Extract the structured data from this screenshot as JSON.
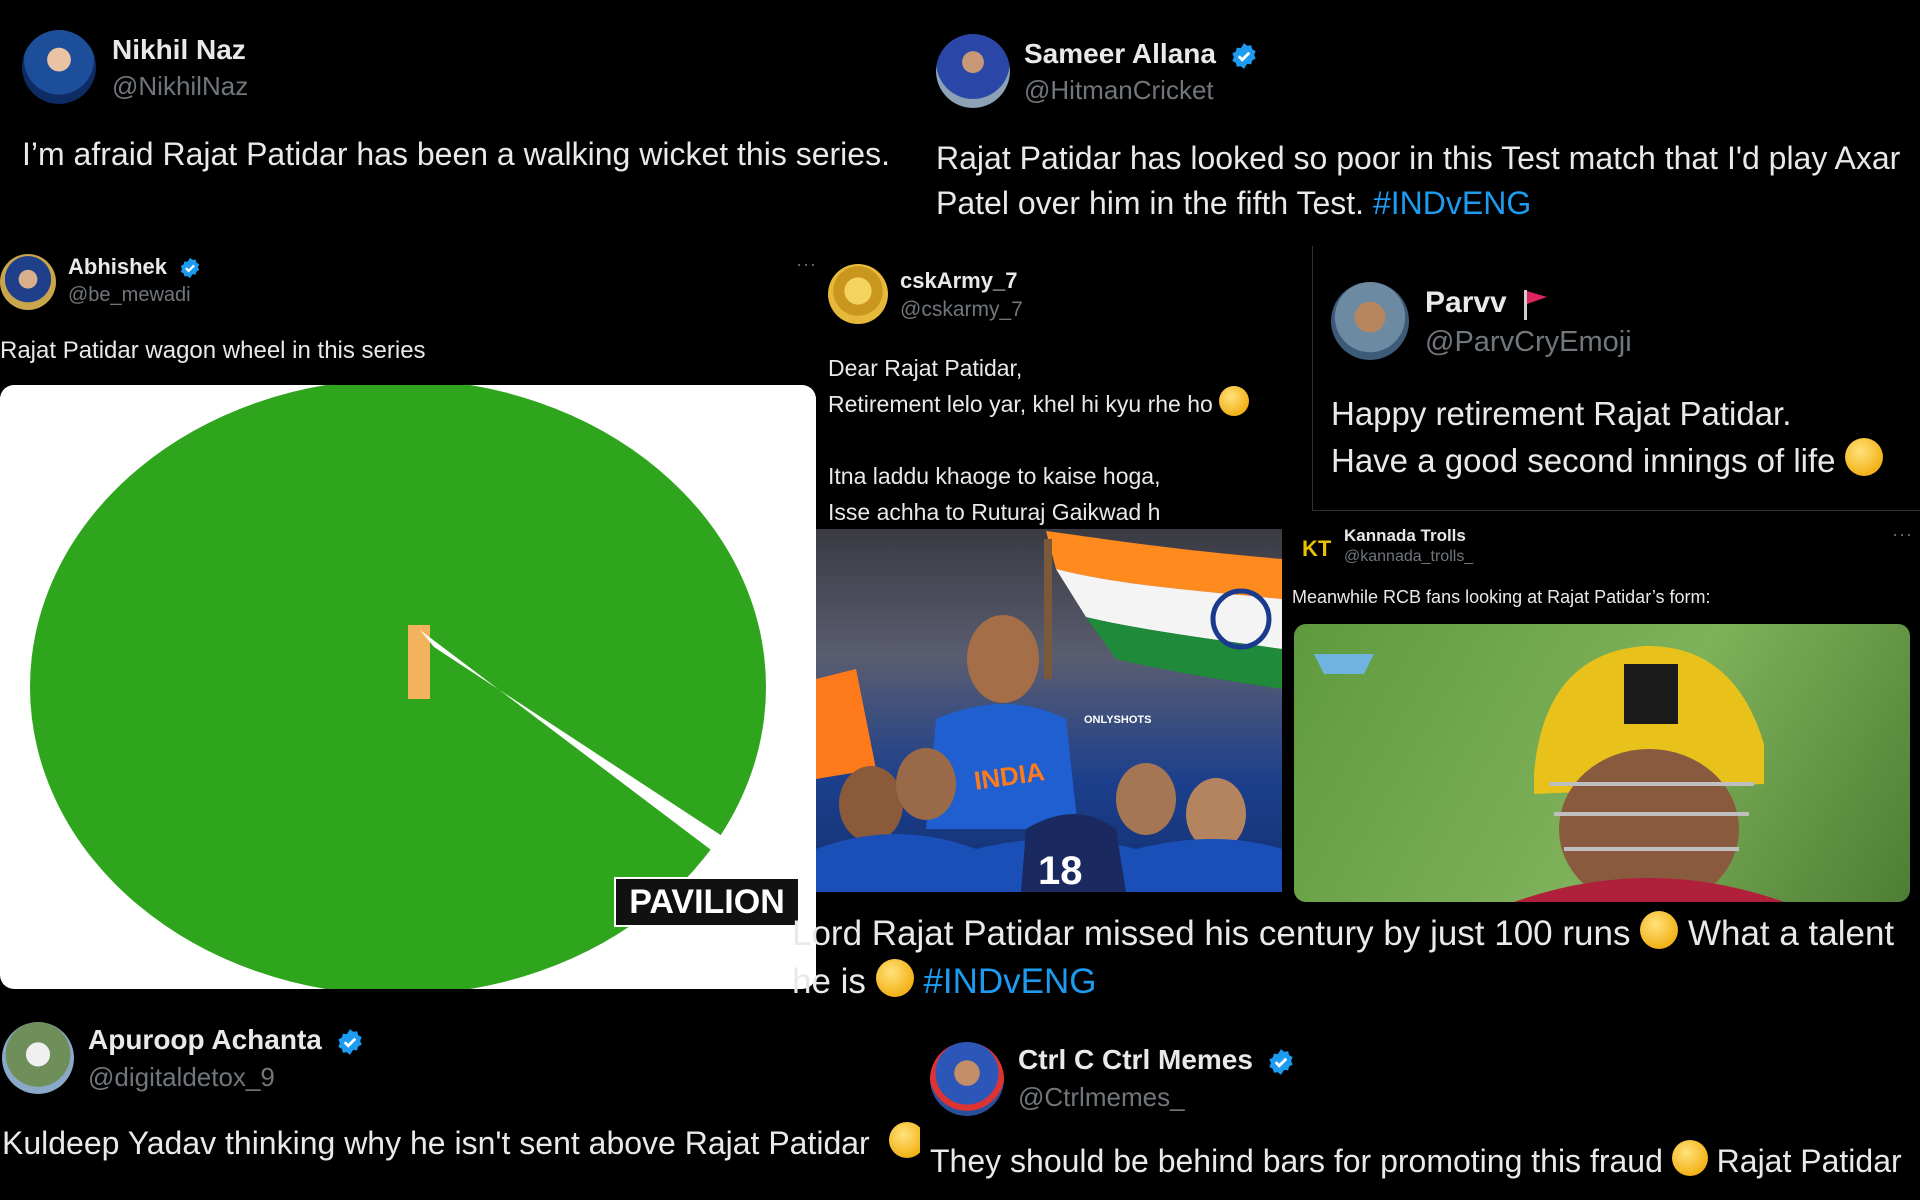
{
  "tweets": [
    {
      "name": "Nikhil Naz",
      "handle": "@NikhilNaz",
      "text": "I’m afraid Rajat Patidar has been a walking wicket this series."
    },
    {
      "name": "Sameer Allana",
      "handle": "@HitmanCricket",
      "text": "Rajat Patidar has looked so poor in this Test match that I'd play Axar Patel over him in the fifth Test.",
      "hashtag": "#INDvENG"
    },
    {
      "name": "Abhishek",
      "handle": "@be_mewadi",
      "text": "Rajat Patidar wagon wheel in this series",
      "image_label": "PAVILION"
    },
    {
      "name": "cskArmy_7",
      "handle": "@cskarmy_7",
      "lines": [
        "Dear Rajat Patidar,",
        "Retirement lelo yar, khel hi kyu rhe ho",
        "Itna laddu khaoge to kaise hoga,",
        "Isse achha to Ruturaj Gaikwad  h"
      ],
      "image_watermark": "ONLYSHOTS",
      "jersey_text": "INDIA",
      "jersey_number": "18"
    },
    {
      "name": "Parvv",
      "handle": "@ParvCryEmoji",
      "lines": [
        "Happy retirement Rajat Patidar.",
        "Have a good second innings of life"
      ]
    },
    {
      "name": "Kannada Trolls",
      "handle": "@kannada_trolls_",
      "text": "Meanwhile RCB fans looking at Rajat Patidar’s form:",
      "logo": "KT"
    },
    {
      "text": "Lord Rajat Patidar missed his century by just 100 runs",
      "text2": "What a talent",
      "text3": "he is",
      "hashtag": "#INDvENG"
    },
    {
      "name": "Apuroop Achanta",
      "handle": "@digitaldetox_9",
      "text": "Kuldeep Yadav thinking why he isn't sent above Rajat Patidar"
    },
    {
      "name": "Ctrl C Ctrl Memes",
      "handle": "@Ctrlmemes_",
      "text": "They should be behind bars for promoting this fraud",
      "text2": "Rajat Patidar"
    }
  ],
  "more_icon": "···",
  "colors": {
    "link": "#1d9bf0",
    "field": "#2fa51e",
    "verified": "#1d9bf0"
  }
}
